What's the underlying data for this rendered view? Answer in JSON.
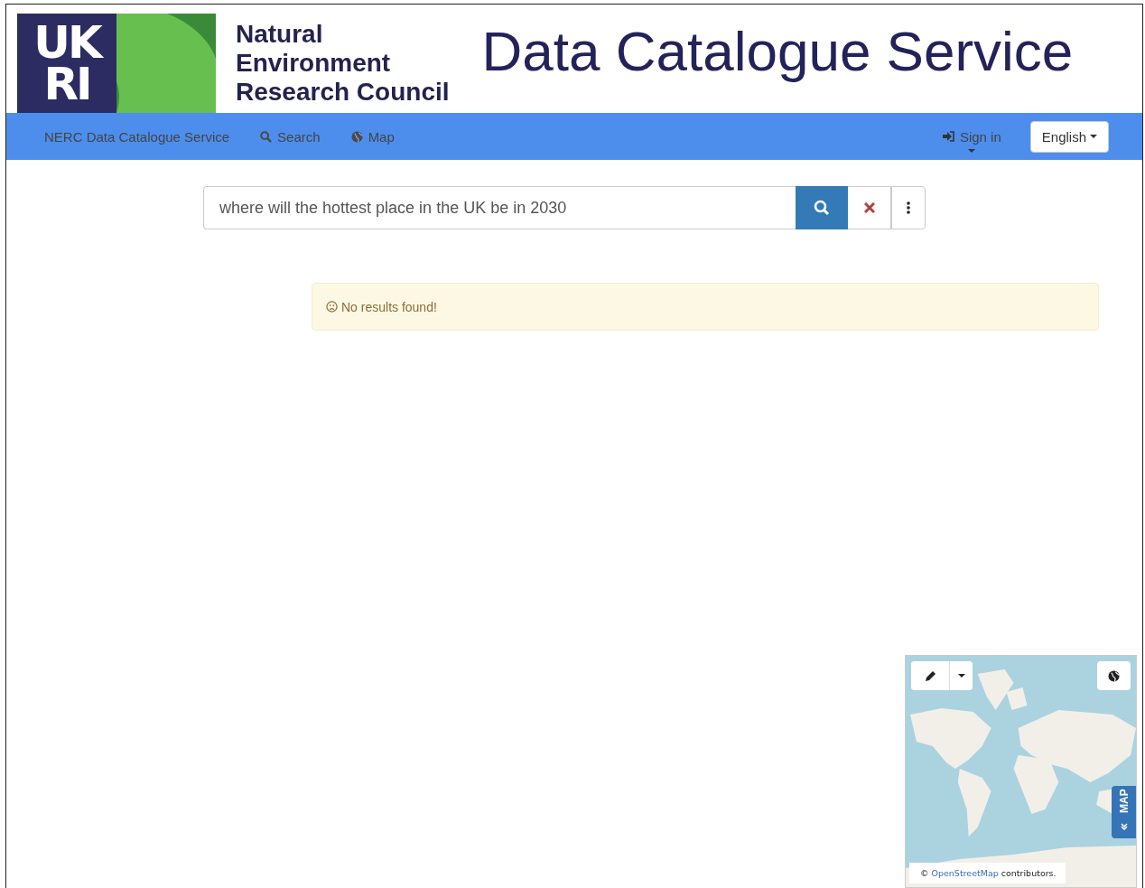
{
  "header": {
    "logo_text": [
      "UK",
      "RI"
    ],
    "council_name": [
      "Natural",
      "Environment",
      "Research Council"
    ],
    "site_title": "Data Catalogue Service"
  },
  "nav": {
    "brand": "NERC Data Catalogue Service",
    "items": [
      {
        "kind": "search",
        "label": "Search"
      },
      {
        "kind": "map",
        "label": "Map"
      }
    ],
    "sign_in": "Sign in",
    "language": "English"
  },
  "search": {
    "value": "where will the hottest place in the UK be in 2030"
  },
  "alert": {
    "message": "No results found!"
  },
  "map": {
    "attribution_prefix": "©",
    "attribution_link": "OpenStreetMap",
    "attribution_suffix": "contributors.",
    "tab_label": "MAP"
  }
}
